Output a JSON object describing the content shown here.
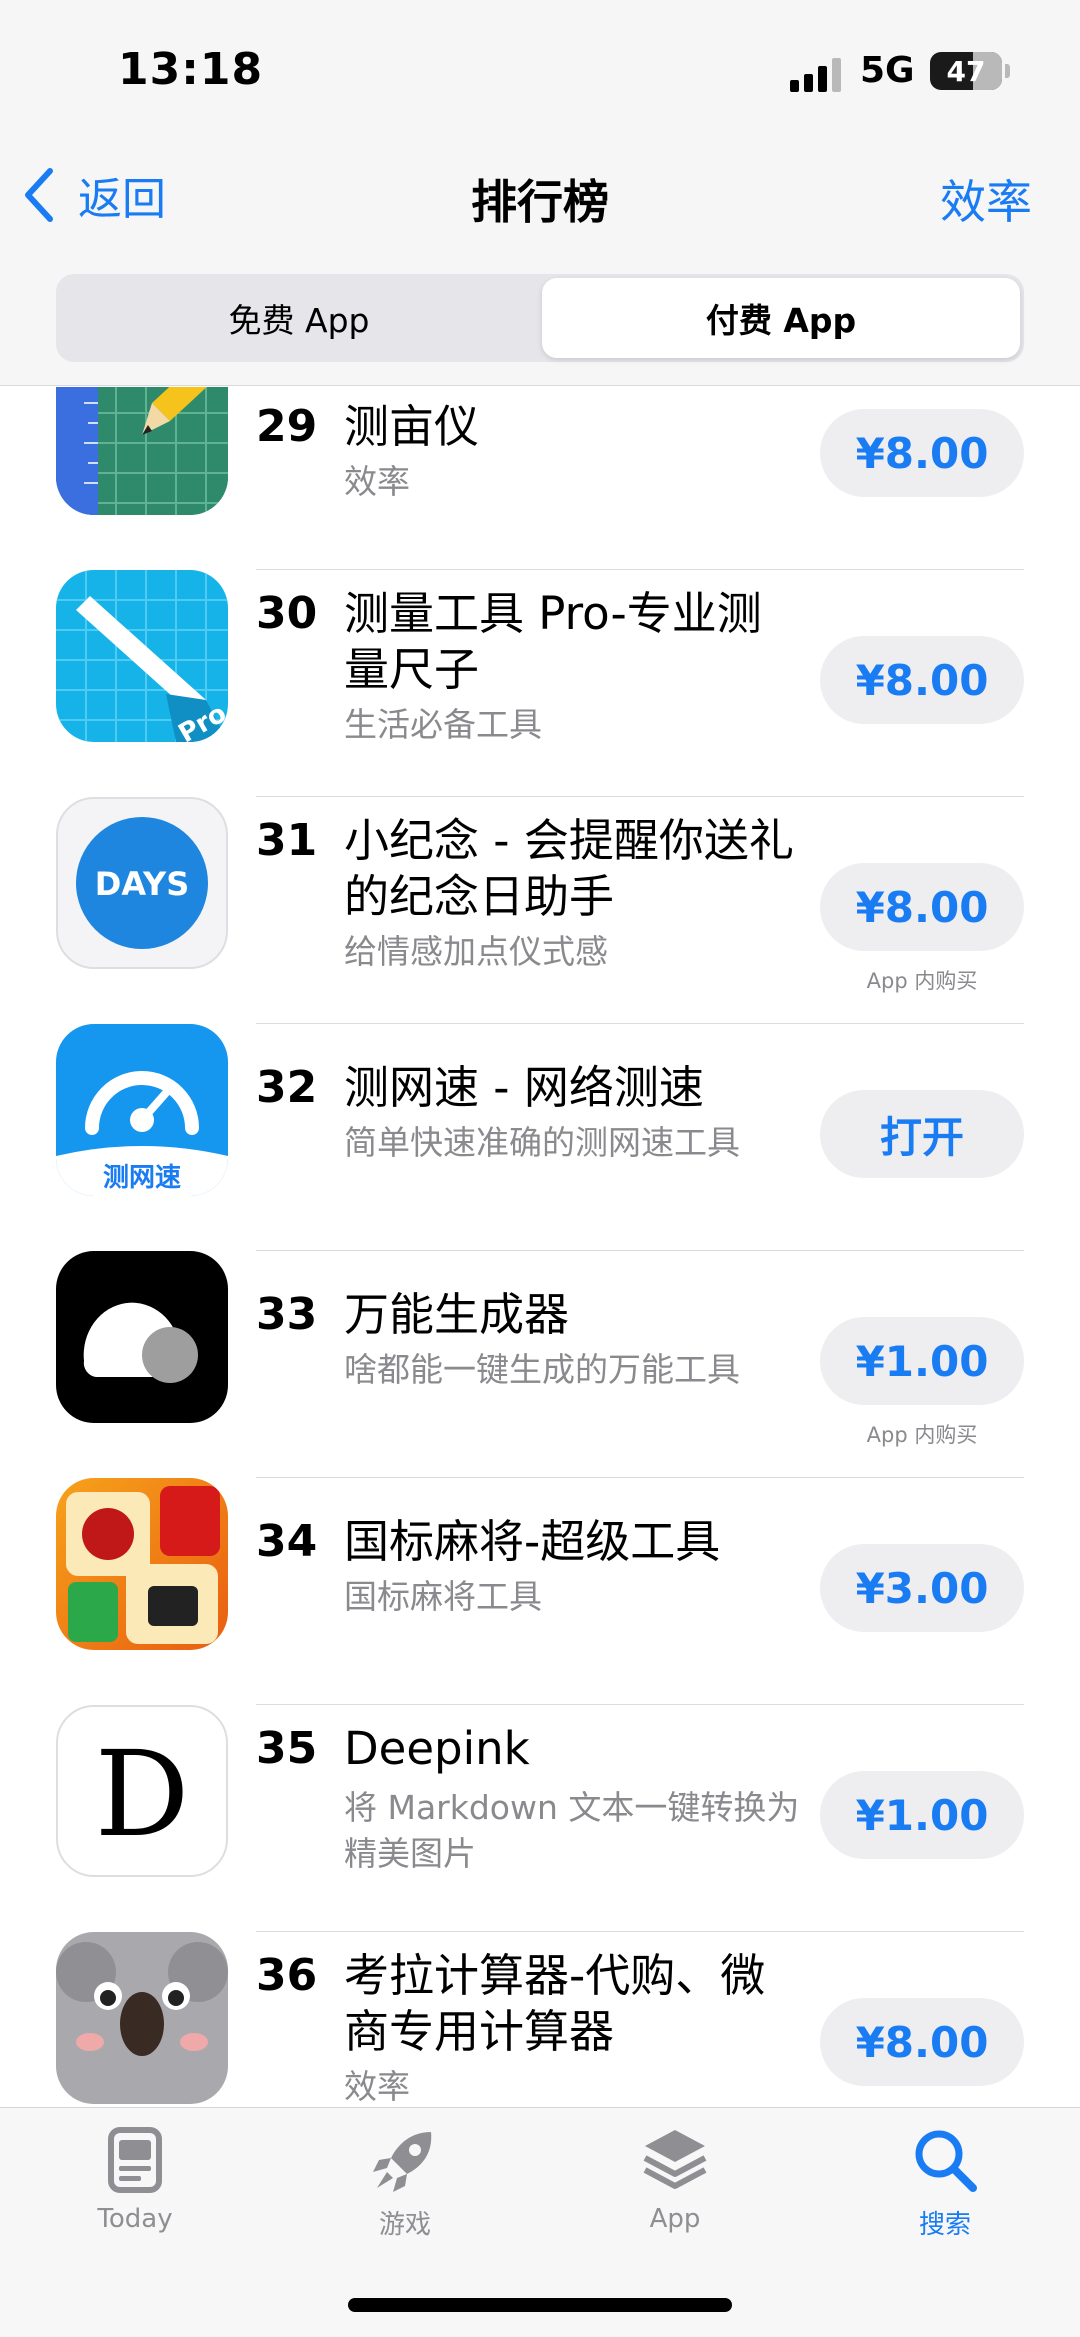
{
  "status_bar": {
    "time": "13:18",
    "network": "5G",
    "battery": "47",
    "battery_level": 0.47
  },
  "header": {
    "back_label": "返回",
    "title": "排行榜",
    "category": "效率",
    "segments": [
      {
        "label": "免费 App",
        "selected": false
      },
      {
        "label": "付费 App",
        "selected": true
      }
    ]
  },
  "apps": [
    {
      "rank": "29",
      "name": "测亩仪",
      "subtitle": "效率",
      "action": "¥8.00",
      "iap": "",
      "icon": "ruler-grid-pencil-icon"
    },
    {
      "rank": "30",
      "name": "测量工具 Pro-专业测量尺子",
      "subtitle": "生活必备工具",
      "action": "¥8.00",
      "iap": "",
      "icon": "ruler-pro-icon"
    },
    {
      "rank": "31",
      "name": "小纪念 - 会提醒你送礼的纪念日助手",
      "subtitle": "给情感加点仪式感",
      "action": "¥8.00",
      "iap": "App 内购买",
      "icon": "days-icon",
      "icon_text": "DAYS"
    },
    {
      "rank": "32",
      "name": "测网速 - 网络测速",
      "subtitle": "简单快速准确的测网速工具",
      "action": "打开",
      "iap": "",
      "icon": "speedometer-icon",
      "icon_text": "测网速"
    },
    {
      "rank": "33",
      "name": "万能生成器",
      "subtitle": "啥都能一键生成的万能工具",
      "action": "¥1.00",
      "iap": "App 内购买",
      "icon": "generator-icon"
    },
    {
      "rank": "34",
      "name": "国标麻将-超级工具",
      "subtitle": "国标麻将工具",
      "action": "¥3.00",
      "iap": "",
      "icon": "mahjong-icon"
    },
    {
      "rank": "35",
      "name": "Deepink",
      "subtitle": "将 Markdown 文本一键转换为精美图片",
      "action": "¥1.00",
      "iap": "",
      "icon": "deepink-icon",
      "icon_text": "D"
    },
    {
      "rank": "36",
      "name": "考拉计算器-代购、微商专用计算器",
      "subtitle": "效率",
      "action": "¥8.00",
      "iap": "",
      "icon": "koala-icon"
    }
  ],
  "tabbar": [
    {
      "label": "Today",
      "icon": "today-icon",
      "active": false
    },
    {
      "label": "游戏",
      "icon": "rocket-icon",
      "active": false
    },
    {
      "label": "App",
      "icon": "app-stack-icon",
      "active": false
    },
    {
      "label": "搜索",
      "icon": "search-icon",
      "active": true
    }
  ],
  "colors": {
    "accent": "#1a7cf3",
    "secondary_text": "#8a8a8e",
    "button_bg": "#eeeef0"
  }
}
